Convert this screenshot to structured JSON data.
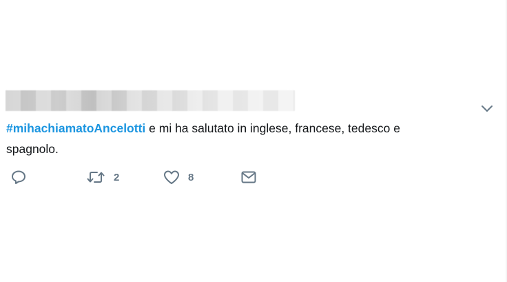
{
  "tweet": {
    "hashtag": "#mihachiamatoAncelotti",
    "text_line1": " e mi ha salutato in inglese, francese, tedesco e",
    "text_line2": "spagnolo.",
    "header_blurred": true
  },
  "actions": {
    "reply": {
      "icon": "reply-icon"
    },
    "retweet": {
      "icon": "retweet-icon",
      "count": "2"
    },
    "like": {
      "icon": "heart-icon",
      "count": "8"
    },
    "dm": {
      "icon": "envelope-icon"
    }
  },
  "menu": {
    "icon": "chevron-down-icon"
  },
  "colors": {
    "hashtag": "#1b95e0",
    "text": "#14171a",
    "icon": "#657786"
  }
}
